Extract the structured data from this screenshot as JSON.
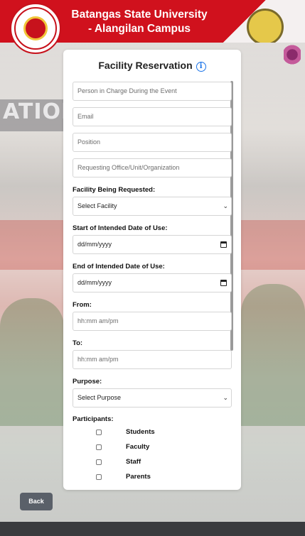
{
  "header": {
    "title": "Batangas State University - Alangilan Campus",
    "bg_color": "#d0111d",
    "logo_text": "BATANGAS STATE UNIVERSITY"
  },
  "form": {
    "title": "Facility Reservation",
    "info_icon": "info-icon",
    "person_in_charge_placeholder": "Person in Charge During the Event",
    "email_placeholder": "Email",
    "position_placeholder": "Position",
    "office_placeholder": "Requesting Office/Unit/Organization",
    "facility_label": "Facility Being Requested:",
    "facility_value": "Select Facility",
    "start_date_label": "Start of Intended Date of Use:",
    "start_date_value": "dd/mm/yyyy",
    "end_date_label": "End of Intended Date of Use:",
    "end_date_value": "dd/mm/yyyy",
    "from_label": "From:",
    "from_value": "hh:mm am/pm",
    "to_label": "To:",
    "to_value": "hh:mm am/pm",
    "purpose_label": "Purpose:",
    "purpose_value": "Select Purpose",
    "participants_label": "Participants:",
    "participants": [
      "Students",
      "Faculty",
      "Staff",
      "Parents"
    ]
  },
  "back_label": "Back",
  "colors": {
    "accent_red": "#d0111d",
    "info_blue": "#1a73e8",
    "button_gray": "#5a6069",
    "footer": "#3a3b3e"
  }
}
